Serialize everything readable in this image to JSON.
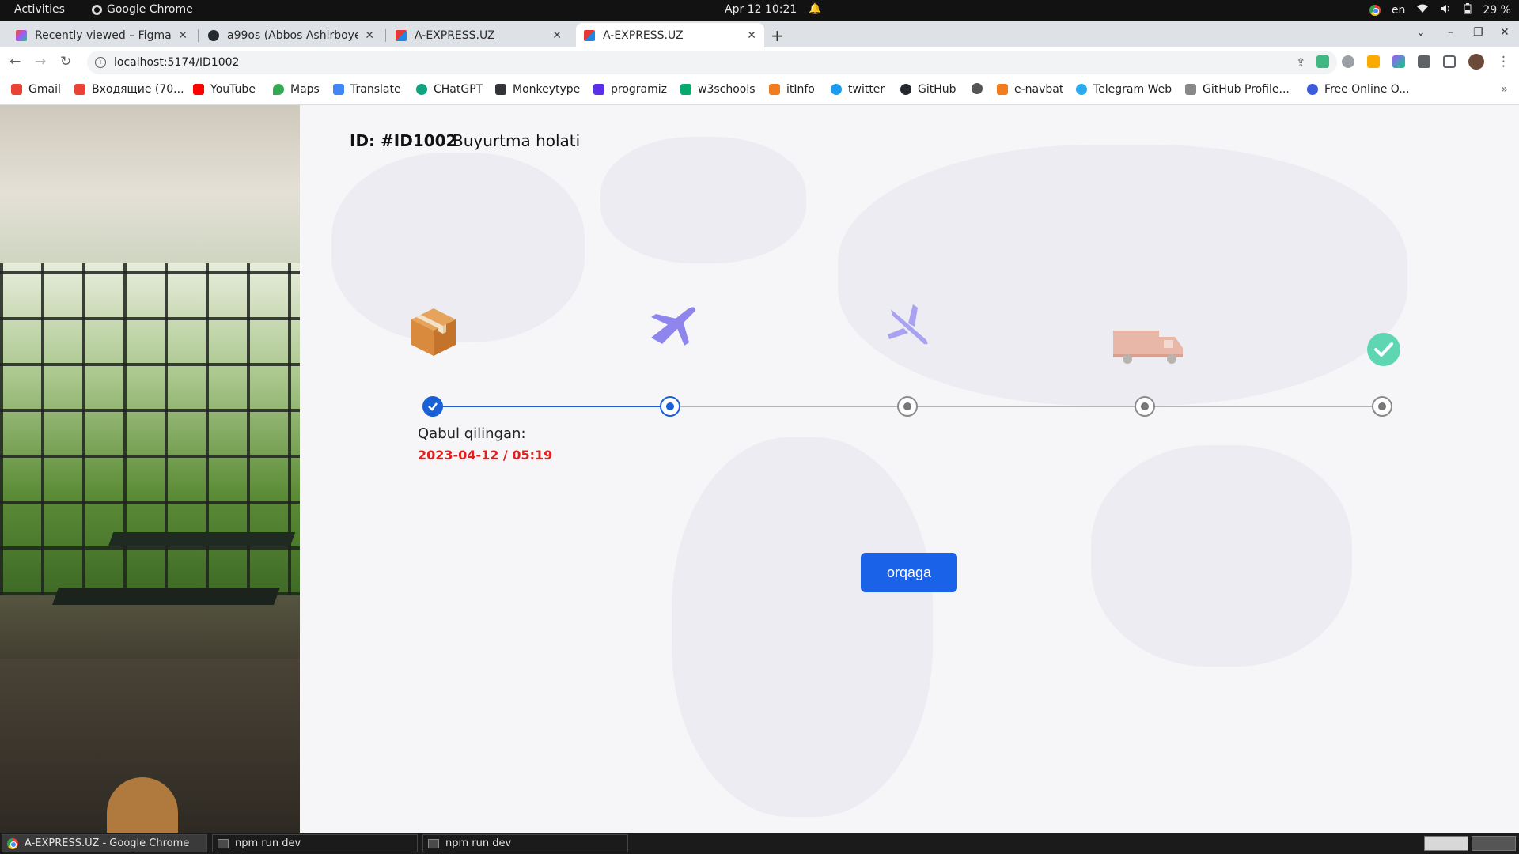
{
  "system": {
    "activities": "Activities",
    "app_name": "Google Chrome",
    "clock": "Apr 12  10:21",
    "lang": "en",
    "battery": "29 %"
  },
  "tabs": [
    {
      "title": "Recently viewed – Figma",
      "favicon": "figma-icon"
    },
    {
      "title": "a99os (Abbos Ashirboyev)",
      "favicon": "github-icon"
    },
    {
      "title": "A-EXPRESS.UZ",
      "favicon": "a-express-icon"
    },
    {
      "title": "A-EXPRESS.UZ",
      "favicon": "a-express-icon",
      "active": true
    }
  ],
  "address": {
    "url": "localhost:5174/ID1002"
  },
  "bookmarks": [
    {
      "label": "Gmail",
      "color": "#ea4335"
    },
    {
      "label": "Входящие (70...",
      "color": "#ea4335"
    },
    {
      "label": "YouTube",
      "color": "#ff0000"
    },
    {
      "label": "Maps",
      "color": "#34a853"
    },
    {
      "label": "Translate",
      "color": "#4285f4"
    },
    {
      "label": "CHatGPT",
      "color": "#10a37f"
    },
    {
      "label": "Monkeytype",
      "color": "#323437"
    },
    {
      "label": "programiz",
      "color": "#5b2ee8"
    },
    {
      "label": "w3schools",
      "color": "#04aa6d"
    },
    {
      "label": "itInfo",
      "color": "#f07d1f"
    },
    {
      "label": "twitter",
      "color": "#1d9bf0"
    },
    {
      "label": "GitHub",
      "color": "#24292f"
    },
    {
      "label": "",
      "color": "#555555"
    },
    {
      "label": "e-navbat",
      "color": "#f07d1f"
    },
    {
      "label": "Telegram Web",
      "color": "#2aabee"
    },
    {
      "label": "GitHub Profile...",
      "color": "#888888"
    },
    {
      "label": "Free Online O...",
      "color": "#3b5bdb"
    }
  ],
  "order": {
    "id_label": "ID: #ID1002",
    "title": "Buyurtma holati",
    "status_label": "Qabul qilingan:",
    "status_date": "2023-04-12 / 05:19",
    "current_step": 2,
    "steps": [
      {
        "icon": "package-icon",
        "state": "done"
      },
      {
        "icon": "airplane-takeoff-icon",
        "state": "current"
      },
      {
        "icon": "airplane-landing-icon",
        "state": "pending"
      },
      {
        "icon": "delivery-truck-icon",
        "state": "pending"
      },
      {
        "icon": "check-circle-icon",
        "state": "pending"
      }
    ],
    "back_button": "orqaga"
  },
  "colors": {
    "accent": "#1a63e8",
    "date_red": "#e0201f",
    "check_green": "#5fd6b2",
    "plane_purple": "#8e86ec"
  },
  "taskbar": [
    {
      "label": "A-EXPRESS.UZ - Google Chrome",
      "icon": "chrome-icon",
      "active": true
    },
    {
      "label": "npm run dev",
      "icon": "terminal-icon"
    },
    {
      "label": "npm run dev",
      "icon": "terminal-icon"
    }
  ]
}
